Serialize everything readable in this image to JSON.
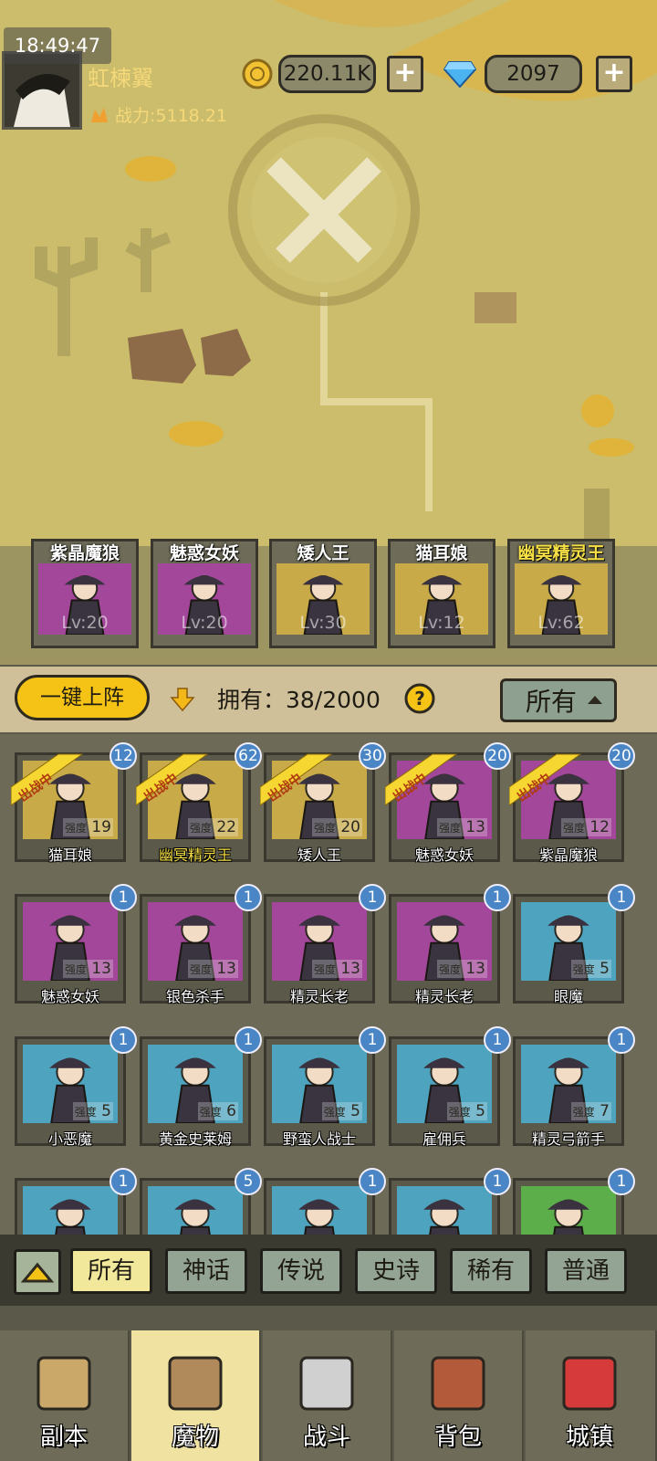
{
  "status_bar": {
    "time": "18:49:47"
  },
  "player": {
    "name": "虹楝翼",
    "power_label": "战力:5118.21",
    "gold": "220.11K",
    "gems": "2097",
    "gold_add_label": "+",
    "gems_add_label": "+"
  },
  "lineup": [
    {
      "name": "紫晶魔狼",
      "level": "Lv:20",
      "color": "#a3479a"
    },
    {
      "name": "魅惑女妖",
      "level": "Lv:20",
      "color": "#a3479a"
    },
    {
      "name": "矮人王",
      "level": "Lv:30",
      "color": "#c8aa49"
    },
    {
      "name": "猫耳娘",
      "level": "Lv:12",
      "color": "#c8aa49"
    },
    {
      "name": "幽冥精灵王",
      "level": "Lv:62",
      "color": "#c8aa49",
      "highlight": true
    }
  ],
  "panel": {
    "deploy_button": "一键上阵",
    "own_label": "拥有：38/2000",
    "help_icon": "?",
    "filter_value": "所有"
  },
  "monsters": [
    {
      "name": "猫耳娘",
      "strength": "19",
      "count": "12",
      "deployed": true,
      "bg": "#c8aa49"
    },
    {
      "name": "幽冥精灵王",
      "strength": "22",
      "count": "62",
      "deployed": true,
      "bg": "#c8aa49",
      "highlight": true
    },
    {
      "name": "矮人王",
      "strength": "20",
      "count": "30",
      "deployed": true,
      "bg": "#c8aa49"
    },
    {
      "name": "魅惑女妖",
      "strength": "13",
      "count": "20",
      "deployed": true,
      "bg": "#a3479a"
    },
    {
      "name": "紫晶魔狼",
      "strength": "12",
      "count": "20",
      "deployed": true,
      "bg": "#a3479a"
    },
    {
      "name": "魅惑女妖",
      "strength": "13",
      "count": "1",
      "deployed": false,
      "bg": "#a3479a"
    },
    {
      "name": "银色杀手",
      "strength": "13",
      "count": "1",
      "deployed": false,
      "bg": "#a3479a"
    },
    {
      "name": "精灵长老",
      "strength": "13",
      "count": "1",
      "deployed": false,
      "bg": "#a3479a"
    },
    {
      "name": "精灵长老",
      "strength": "13",
      "count": "1",
      "deployed": false,
      "bg": "#a3479a"
    },
    {
      "name": "眼魔",
      "strength": "5",
      "count": "1",
      "deployed": false,
      "bg": "#4ea3bf"
    },
    {
      "name": "小恶魔",
      "strength": "5",
      "count": "1",
      "deployed": false,
      "bg": "#4ea3bf"
    },
    {
      "name": "黄金史莱姆",
      "strength": "6",
      "count": "1",
      "deployed": false,
      "bg": "#4ea3bf"
    },
    {
      "name": "野蛮人战士",
      "strength": "5",
      "count": "1",
      "deployed": false,
      "bg": "#4ea3bf"
    },
    {
      "name": "雇佣兵",
      "strength": "5",
      "count": "1",
      "deployed": false,
      "bg": "#4ea3bf"
    },
    {
      "name": "精灵弓箭手",
      "strength": "7",
      "count": "1",
      "deployed": false,
      "bg": "#4ea3bf"
    },
    {
      "name": "",
      "strength": "",
      "count": "1",
      "deployed": false,
      "bg": "#4ea3bf"
    },
    {
      "name": "",
      "strength": "",
      "count": "5",
      "deployed": false,
      "bg": "#4ea3bf"
    },
    {
      "name": "",
      "strength": "",
      "count": "1",
      "deployed": false,
      "bg": "#4ea3bf"
    },
    {
      "name": "",
      "strength": "",
      "count": "1",
      "deployed": false,
      "bg": "#4ea3bf"
    },
    {
      "name": "",
      "strength": "",
      "count": "1",
      "deployed": false,
      "bg": "#5bae4a"
    }
  ],
  "labels": {
    "deployed_badge": "出战中",
    "strength_key": "强度"
  },
  "rarity_tabs": [
    "所有",
    "神话",
    "传说",
    "史诗",
    "稀有",
    "普通"
  ],
  "rarity_active": "所有",
  "nav": [
    {
      "label": "副本",
      "icon": "map-icon"
    },
    {
      "label": "魔物",
      "icon": "monster-helmet-icon",
      "active": true
    },
    {
      "label": "战斗",
      "icon": "crossed-swords-icon"
    },
    {
      "label": "背包",
      "icon": "backpack-icon"
    },
    {
      "label": "城镇",
      "icon": "shop-icon"
    }
  ]
}
